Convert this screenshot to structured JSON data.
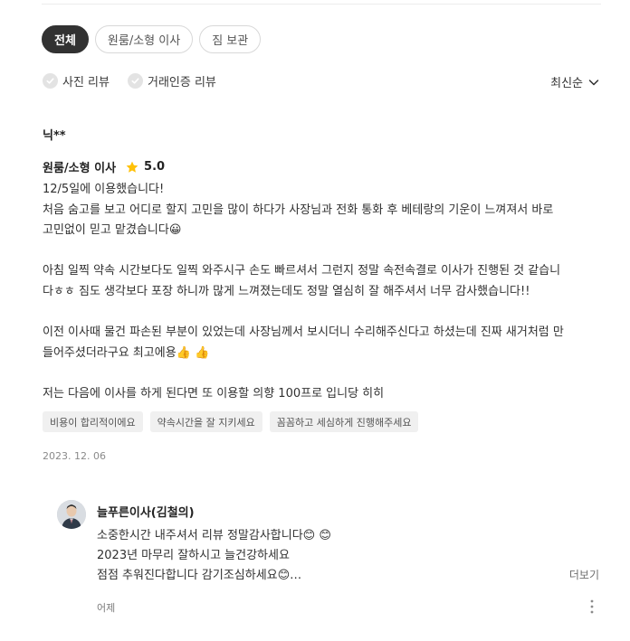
{
  "tabs": [
    {
      "label": "전체",
      "active": true
    },
    {
      "label": "원룸/소형 이사",
      "active": false
    },
    {
      "label": "짐 보관",
      "active": false
    }
  ],
  "filters": {
    "photo_review": "사진 리뷰",
    "verified_review": "거래인증 리뷰"
  },
  "sort": {
    "label": "최신순"
  },
  "review": {
    "author": "닉**",
    "service": "원룸/소형 이사",
    "rating": "5.0",
    "paragraphs": [
      [
        "12/5일에 이용했습니다!",
        "처음 숨고를 보고 어디로 할지 고민을 많이 하다가 사장님과 전화 통화 후 베테랑의 기운이 느껴져서 바로",
        "고민없이 믿고 맡겼습니다😀"
      ],
      [
        "아침 일찍 약속 시간보다도 일찍 와주시구 손도 빠르셔서 그런지 정말 속전속결로 이사가 진행된 것 같습니",
        "다ㅎㅎ 짐도 생각보다 포장 하니까 많게 느껴졌는데도 정말 열심히 잘 해주셔서 너무 감사했습니다!!"
      ],
      [
        "이전 이사때 물건 파손된 부분이 있었는데 사장님께서 보시더니 수리해주신다고 하셨는데 진짜 새거처럼 만",
        "들어주셨더라구요 최고에용👍 👍"
      ],
      [
        "저는 다음에 이사를 하게 된다면 또 이용할 의향 100프로 입니당 히히"
      ]
    ],
    "tags": [
      "비용이 합리적이에요",
      "약속시간을 잘 지키세요",
      "꼼꼼하고 세심하게 진행해주세요"
    ],
    "date": "2023. 12. 06"
  },
  "reply": {
    "name": "늘푸른이사(김철의)",
    "lines": [
      "소중한시간 내주셔서 리뷰 정말감사합니다😊 😊",
      "2023년 마무리 잘하시고 늘건강하세요",
      "점점 추워진다합니다 감기조심하세요😊…"
    ],
    "more_label": "더보기",
    "time": "어제"
  },
  "colors": {
    "active_tab_bg": "#323232",
    "star": "#ffc107",
    "chip_bg": "#f0f0f0"
  },
  "icons": {
    "check": "check-circle-icon",
    "sort": "chevron-down-icon",
    "rating": "star-icon",
    "menu": "more-vertical-icon"
  }
}
